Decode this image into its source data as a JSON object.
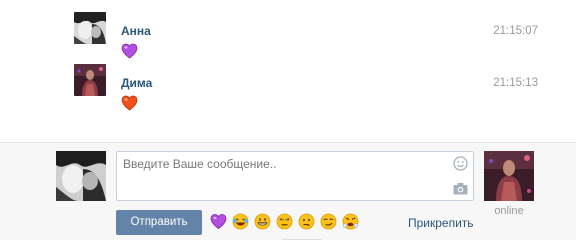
{
  "messages": [
    {
      "author": "Анна",
      "time": "21:15:07",
      "emoji": "purple-heart"
    },
    {
      "author": "Дима",
      "time": "21:15:13",
      "emoji": "orange-heart"
    }
  ],
  "composer": {
    "placeholder": "Введите Ваше сообщение..",
    "send_label": "Отправить",
    "attach_label": "Прикрепить",
    "status": "online",
    "quick_emojis": [
      "purple-heart",
      "joy",
      "grin",
      "unamused",
      "confused",
      "smirk",
      "triumph"
    ]
  },
  "colors": {
    "link": "#2b587a",
    "button": "#6383a8",
    "time": "#999999",
    "composer_bg": "#f7f7f7"
  }
}
